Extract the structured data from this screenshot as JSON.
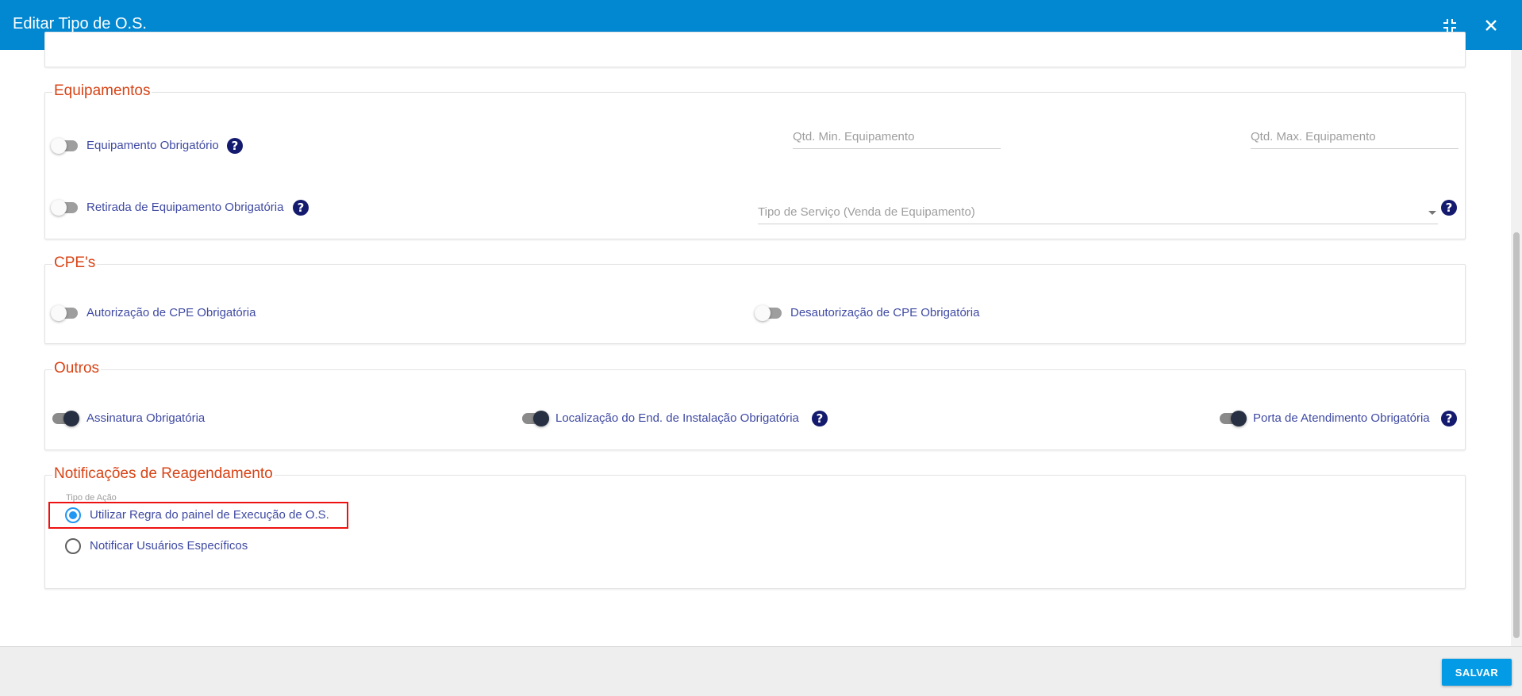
{
  "header": {
    "title": "Editar Tipo de O.S.",
    "minimize_icon": "exit-fullscreen-icon",
    "close_icon": "close-icon"
  },
  "sections": {
    "equipamentos": {
      "legend": "Equipamentos",
      "equipamento_obrigatorio": {
        "label": "Equipamento Obrigatório",
        "on": false
      },
      "qtd_min": {
        "placeholder": "Qtd. Min. Equipamento"
      },
      "qtd_max": {
        "placeholder": "Qtd. Max. Equipamento"
      },
      "retirada_obrigatoria": {
        "label": "Retirada de Equipamento Obrigatória",
        "on": false
      },
      "tipo_servico": {
        "placeholder": "Tipo de Serviço (Venda de Equipamento)"
      }
    },
    "cpes": {
      "legend": "CPE's",
      "autorizacao": {
        "label": "Autorização de CPE Obrigatória",
        "on": false
      },
      "desautorizacao": {
        "label": "Desautorização de CPE Obrigatória",
        "on": false
      }
    },
    "outros": {
      "legend": "Outros",
      "assinatura": {
        "label": "Assinatura Obrigatória",
        "on": true
      },
      "localizacao": {
        "label": "Localização do End. de Instalação Obrigatória",
        "on": true
      },
      "porta": {
        "label": "Porta de Atendimento Obrigatória",
        "on": true
      }
    },
    "notificacoes": {
      "legend": "Notificações de Reagendamento",
      "tipo_acao_label": "Tipo de Ação",
      "options": [
        {
          "label": "Utilizar Regra do painel de Execução de O.S.",
          "checked": true
        },
        {
          "label": "Notificar Usuários Específicos",
          "checked": false
        }
      ]
    }
  },
  "help_glyph": "?",
  "footer": {
    "save_label": "SALVAR"
  },
  "colors": {
    "header_bg": "#0288d1",
    "legend": "#d84315",
    "label": "#3f4aa3",
    "help_icon": "#141a6e",
    "save_button": "#039be5",
    "radio_checked": "#2196f3",
    "highlight": "#ee1111"
  }
}
